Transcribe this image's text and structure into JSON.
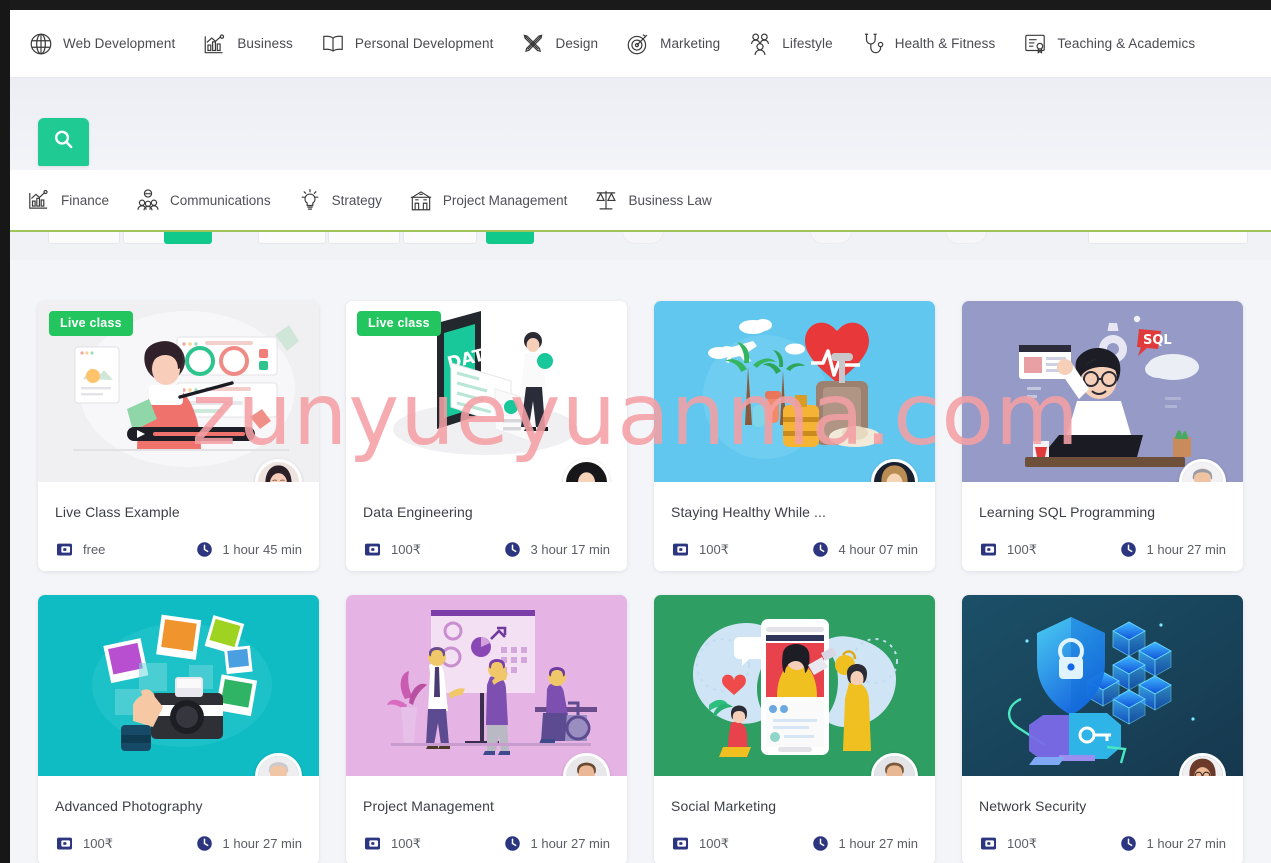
{
  "watermark": "zunyueyuanma.com",
  "colors": {
    "accent_green": "#1fcb92",
    "badge_green": "#23c55e",
    "meta_icon_navy": "#2b3580",
    "watermark_pink": "#f4a0a4",
    "subnav_underline": "#9fc55a"
  },
  "topnav": {
    "items": [
      {
        "label": "Web Development",
        "icon": "globe-icon"
      },
      {
        "label": "Business",
        "icon": "bar-chart-icon"
      },
      {
        "label": "Personal Development",
        "icon": "open-book-icon"
      },
      {
        "label": "Design",
        "icon": "pencil-ruler-icon"
      },
      {
        "label": "Marketing",
        "icon": "target-icon"
      },
      {
        "label": "Lifestyle",
        "icon": "people-group-icon"
      },
      {
        "label": "Health & Fitness",
        "icon": "stethoscope-icon"
      },
      {
        "label": "Teaching & Academics",
        "icon": "certificate-icon"
      }
    ]
  },
  "search": {
    "button_icon": "search-icon",
    "button_label": ""
  },
  "subnav": {
    "items": [
      {
        "label": "Finance",
        "icon": "growth-chart-icon"
      },
      {
        "label": "Communications",
        "icon": "users-icon"
      },
      {
        "label": "Strategy",
        "icon": "lightbulb-icon"
      },
      {
        "label": "Project Management",
        "icon": "building-icon"
      },
      {
        "label": "Business Law",
        "icon": "scales-icon"
      }
    ]
  },
  "cards": [
    {
      "title": "Live Class Example",
      "badge": "Live class",
      "price": "free",
      "duration": "1 hour 45 min",
      "thumb": "woman-presenting-dashboard",
      "thumb_bg": "#f0f0f2",
      "avatar": "woman-long-dark-hair",
      "price_icon": "wallet-icon",
      "duration_icon": "clock-icon"
    },
    {
      "title": "Data Engineering",
      "badge": "Live class",
      "price": "100₹",
      "duration": "3 hour 17 min",
      "thumb": "mobile-data-isometric",
      "thumb_bg": "#ffffff",
      "avatar": "woman-dark-hair",
      "price_icon": "wallet-icon",
      "duration_icon": "clock-icon"
    },
    {
      "title": "Staying Healthy While ...",
      "badge": "",
      "price": "100₹",
      "duration": "4 hour 07 min",
      "thumb": "travel-luggage-heart",
      "thumb_bg": "#62c7ef",
      "avatar": "woman-blonde",
      "price_icon": "wallet-icon",
      "duration_icon": "clock-icon"
    },
    {
      "title": "Learning SQL Programming",
      "badge": "",
      "price": "100₹",
      "duration": "1 hour 27 min",
      "thumb": "developer-at-laptop-sql",
      "thumb_bg": "#959ac7",
      "avatar": "man-plaid-shirt",
      "price_icon": "wallet-icon",
      "duration_icon": "clock-icon"
    },
    {
      "title": "Advanced Photography",
      "badge": "",
      "price": "100₹",
      "duration": "1 hour 27 min",
      "thumb": "camera-photos-hand",
      "thumb_bg": "#10bcc4",
      "avatar": "man-beard-pink-shirt",
      "price_icon": "wallet-icon",
      "duration_icon": "clock-icon"
    },
    {
      "title": "Project Management",
      "badge": "",
      "price": "100₹",
      "duration": "1 hour 27 min",
      "thumb": "team-whiteboard-meeting",
      "thumb_bg": "#e6b4e4",
      "avatar": "man-short-hair",
      "price_icon": "wallet-icon",
      "duration_icon": "clock-icon"
    },
    {
      "title": "Social Marketing",
      "badge": "",
      "price": "100₹",
      "duration": "1 hour 27 min",
      "thumb": "social-media-phone",
      "thumb_bg": "#2e9e63",
      "avatar": "man-dark-sweater",
      "price_icon": "wallet-icon",
      "duration_icon": "clock-icon"
    },
    {
      "title": "Network Security",
      "badge": "",
      "price": "100₹",
      "duration": "1 hour 27 min",
      "thumb": "shield-lock-isometric",
      "thumb_bg": "#1d4f68",
      "avatar": "woman-glasses-brown-hair",
      "price_icon": "wallet-icon",
      "duration_icon": "clock-icon"
    }
  ]
}
